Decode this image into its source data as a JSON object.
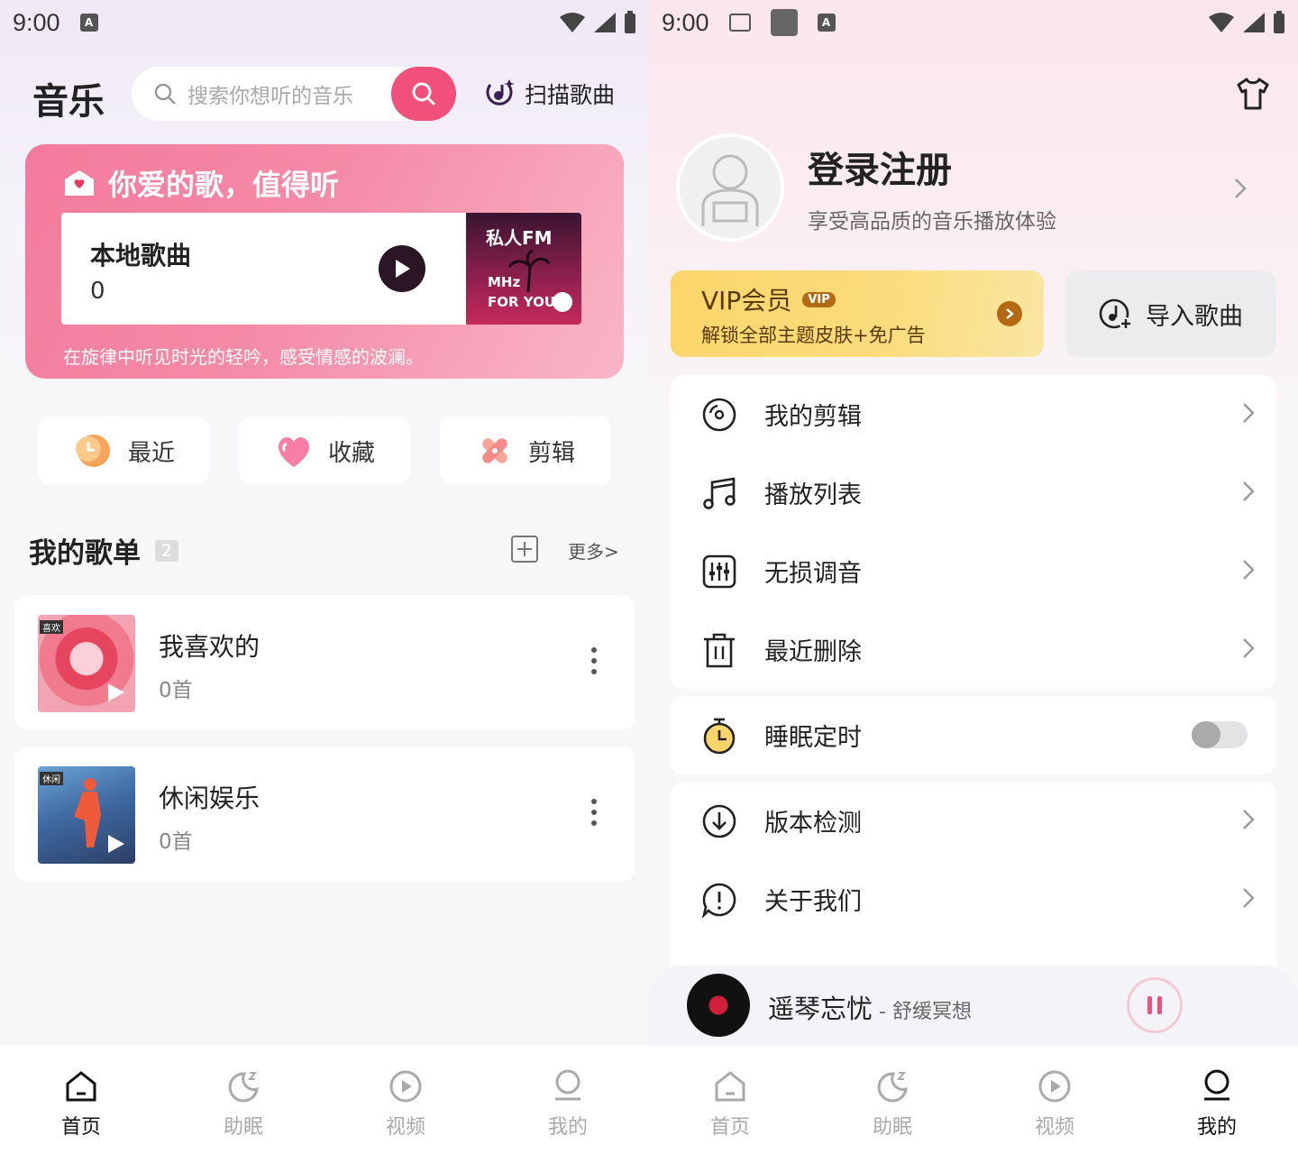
{
  "status_bar": {
    "time": "9:00"
  },
  "home": {
    "title": "音乐",
    "search_placeholder": "搜索你想听的音乐",
    "scan_label": "扫描歌曲",
    "banner": {
      "title": "你爱的歌，值得听",
      "local_title": "本地歌曲",
      "local_count": "0",
      "fm_title": "私人FM",
      "fm_mhz": "MHz",
      "fm_foryou": "FOR YOU",
      "slogan": "在旋律中听见时光的轻吟，感受情感的波澜。"
    },
    "quick": [
      {
        "label": "最近",
        "icon": "recent-clock-icon"
      },
      {
        "label": "收藏",
        "icon": "heart-icon"
      },
      {
        "label": "剪辑",
        "icon": "scissors-icon"
      }
    ],
    "playlists_title": "我的歌单",
    "playlists_count": "2",
    "more_label": "更多>",
    "playlists": [
      {
        "name": "我喜欢的",
        "count": "0首",
        "cover_tag": "喜欢"
      },
      {
        "name": "休闲娱乐",
        "count": "0首",
        "cover_tag": "休闲"
      }
    ]
  },
  "mine": {
    "login_title": "登录注册",
    "login_subtitle": "享受高品质的音乐播放体验",
    "vip_title": "VIP会员",
    "vip_badge": "VIP",
    "vip_subtitle": "解锁全部主题皮肤+免广告",
    "import_label": "导入歌曲",
    "menu_group1": [
      {
        "label": "我的剪辑",
        "icon": "disc-icon"
      },
      {
        "label": "播放列表",
        "icon": "music-note-icon"
      },
      {
        "label": "无损调音",
        "icon": "equalizer-icon"
      },
      {
        "label": "最近删除",
        "icon": "trash-icon"
      }
    ],
    "sleep_timer_label": "睡眠定时",
    "sleep_timer_on": false,
    "menu_group3": [
      {
        "label": "版本检测",
        "icon": "download-circle-icon"
      },
      {
        "label": "关于我们",
        "icon": "info-bubble-icon"
      }
    ],
    "now_playing": {
      "title": "遥琴忘忧",
      "subtitle": " - 舒缓冥想"
    }
  },
  "tabs": [
    {
      "label": "首页",
      "icon": "home-icon"
    },
    {
      "label": "助眠",
      "icon": "moon-sleep-icon"
    },
    {
      "label": "视频",
      "icon": "play-circle-icon"
    },
    {
      "label": "我的",
      "icon": "user-icon"
    }
  ],
  "colors": {
    "accent": "#f0507a",
    "vip_gold": "#fbd56a",
    "text": "#222222"
  }
}
